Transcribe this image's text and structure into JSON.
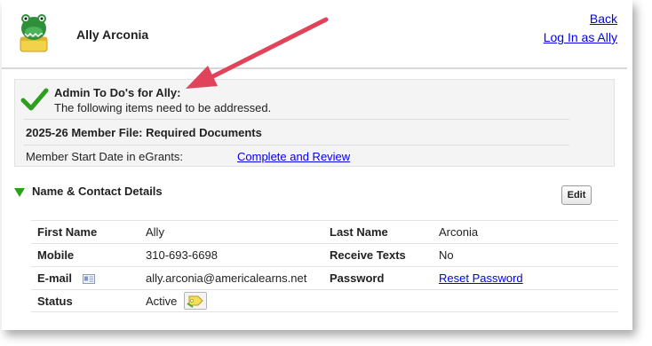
{
  "header": {
    "name": "Ally Arconia",
    "back_label": "Back",
    "login_label": "Log In as Ally"
  },
  "todo": {
    "title": "Admin To Do's for Ally:",
    "subtitle": "The following items need to be addressed.",
    "section": "2025-26 Member File: Required Documents",
    "item_label": "Member Start Date in eGrants:",
    "item_link": "Complete and Review"
  },
  "details": {
    "title": "Name & Contact Details",
    "edit_label": "Edit",
    "first_name_label": "First Name",
    "first_name": "Ally",
    "last_name_label": "Last Name",
    "last_name": "Arconia",
    "mobile_label": "Mobile",
    "mobile": "310-693-6698",
    "receive_texts_label": "Receive Texts",
    "receive_texts": "No",
    "email_label": "E-mail",
    "email": "ally.arconia@americalearns.net",
    "password_label": "Password",
    "password_link": "Reset Password",
    "status_label": "Status",
    "status": "Active"
  },
  "icons": {
    "avatar": "alligator-avatar-icon",
    "check": "green-check-icon",
    "collapse": "triangle-down-icon",
    "email_card": "contact-card-icon",
    "status": "status-tag-icon"
  },
  "colors": {
    "link": "#0000ee",
    "check_green": "#2e9e1f",
    "annotation_arrow": "#e0435a"
  }
}
